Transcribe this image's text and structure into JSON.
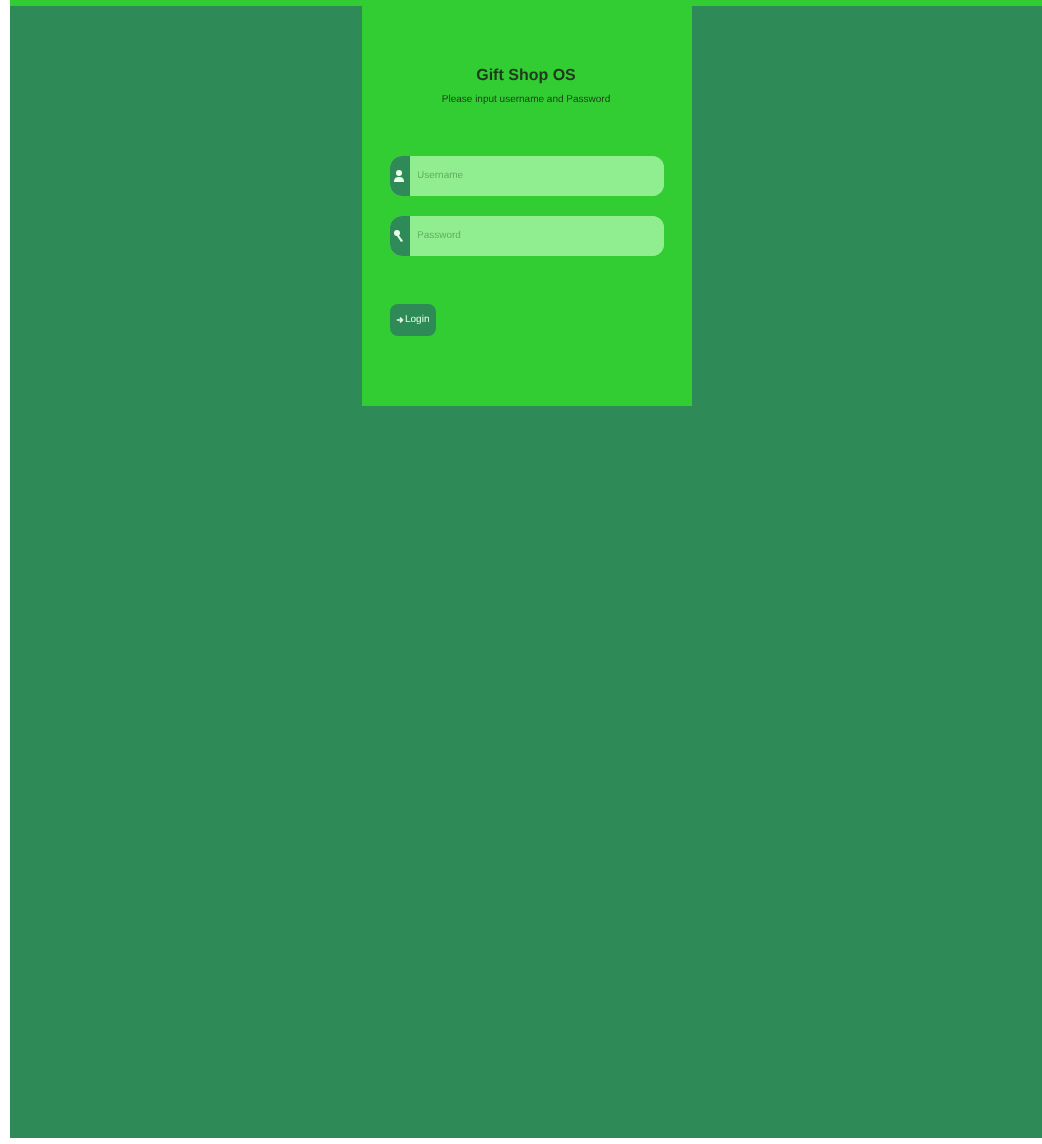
{
  "login": {
    "title": "Gift Shop OS",
    "subtitle": "Please input username and Password",
    "fields": [
      {
        "kind": "user",
        "placeholder": "Username"
      },
      {
        "kind": "key",
        "placeholder": "Password"
      }
    ],
    "button": "Login"
  }
}
